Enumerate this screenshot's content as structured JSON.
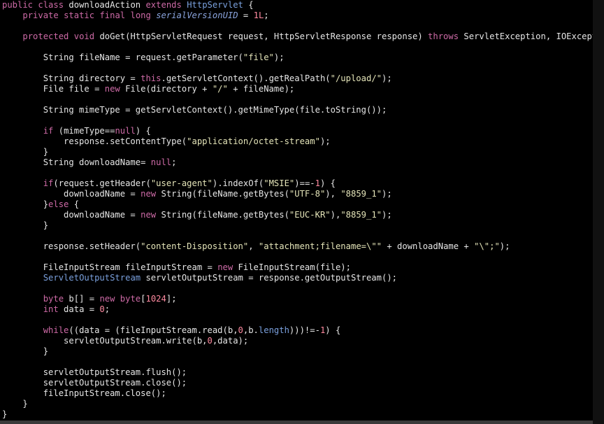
{
  "colors": {
    "background": "#000000",
    "default_text": "#e6e6e6",
    "keyword": "#cd6aa6",
    "type": "#7aa0dd",
    "string": "#e4e4b8",
    "number": "#ff8aa0",
    "field": "#8aa4dd"
  },
  "lines": [
    [
      [
        "kw",
        "public"
      ],
      [
        "p",
        " "
      ],
      [
        "kw",
        "class"
      ],
      [
        "p",
        " downloadAction "
      ],
      [
        "kw",
        "extends"
      ],
      [
        "p",
        " "
      ],
      [
        "type",
        "HttpServlet"
      ],
      [
        "p",
        " {"
      ]
    ],
    [
      [
        "p",
        "    "
      ],
      [
        "kw",
        "private"
      ],
      [
        "p",
        " "
      ],
      [
        "kw",
        "static"
      ],
      [
        "p",
        " "
      ],
      [
        "kw",
        "final"
      ],
      [
        "p",
        " "
      ],
      [
        "kw",
        "long"
      ],
      [
        "p",
        " "
      ],
      [
        "field",
        "serialVersionUID"
      ],
      [
        "p",
        " = "
      ],
      [
        "num",
        "1L"
      ],
      [
        "p",
        ";"
      ]
    ],
    [],
    [
      [
        "p",
        "    "
      ],
      [
        "kw",
        "protected"
      ],
      [
        "p",
        " "
      ],
      [
        "kw",
        "void"
      ],
      [
        "p",
        " doGet(HttpServletRequest request, HttpServletResponse response) "
      ],
      [
        "kw",
        "throws"
      ],
      [
        "p",
        " ServletException, IOException {"
      ]
    ],
    [],
    [
      [
        "p",
        "        String fileName = request.getParameter("
      ],
      [
        "str",
        "\"file\""
      ],
      [
        "p",
        ");"
      ]
    ],
    [],
    [
      [
        "p",
        "        String directory = "
      ],
      [
        "kw",
        "this"
      ],
      [
        "p",
        ".getServletContext().getRealPath("
      ],
      [
        "str",
        "\"/upload/\""
      ],
      [
        "p",
        ");"
      ]
    ],
    [
      [
        "p",
        "        File file = "
      ],
      [
        "kw",
        "new"
      ],
      [
        "p",
        " File(directory + "
      ],
      [
        "str",
        "\"/\""
      ],
      [
        "p",
        " + fileName);"
      ]
    ],
    [],
    [
      [
        "p",
        "        String mimeType = getServletContext().getMimeType(file.toString());"
      ]
    ],
    [],
    [
      [
        "p",
        "        "
      ],
      [
        "kw",
        "if"
      ],
      [
        "p",
        " (mimeType=="
      ],
      [
        "kw",
        "null"
      ],
      [
        "p",
        ") {"
      ]
    ],
    [
      [
        "p",
        "            response.setContentType("
      ],
      [
        "str",
        "\"application/octet-stream\""
      ],
      [
        "p",
        ");"
      ]
    ],
    [
      [
        "p",
        "        }"
      ]
    ],
    [
      [
        "p",
        "        String downloadName= "
      ],
      [
        "kw",
        "null"
      ],
      [
        "p",
        ";"
      ]
    ],
    [],
    [
      [
        "p",
        "        "
      ],
      [
        "kw",
        "if"
      ],
      [
        "p",
        "(request.getHeader("
      ],
      [
        "str",
        "\"user-agent\""
      ],
      [
        "p",
        ").indexOf("
      ],
      [
        "str",
        "\"MSIE\""
      ],
      [
        "p",
        ")==-"
      ],
      [
        "num",
        "1"
      ],
      [
        "p",
        ") {"
      ]
    ],
    [
      [
        "p",
        "            downloadName = "
      ],
      [
        "kw",
        "new"
      ],
      [
        "p",
        " String(fileName.getBytes("
      ],
      [
        "str",
        "\"UTF-8\""
      ],
      [
        "p",
        "), "
      ],
      [
        "str",
        "\"8859_1\""
      ],
      [
        "p",
        ");"
      ]
    ],
    [
      [
        "p",
        "        }"
      ],
      [
        "kw",
        "else"
      ],
      [
        "p",
        " {"
      ]
    ],
    [
      [
        "p",
        "            downloadName = "
      ],
      [
        "kw",
        "new"
      ],
      [
        "p",
        " String(fileName.getBytes("
      ],
      [
        "str",
        "\"EUC-KR\""
      ],
      [
        "p",
        "),"
      ],
      [
        "str",
        "\"8859_1\""
      ],
      [
        "p",
        ");"
      ]
    ],
    [
      [
        "p",
        "        }"
      ]
    ],
    [],
    [
      [
        "p",
        "        response.setHeader("
      ],
      [
        "str",
        "\"content-Disposition\""
      ],
      [
        "p",
        ", "
      ],
      [
        "str",
        "\"attachment;filename=\\\"\""
      ],
      [
        "p",
        " + downloadName + "
      ],
      [
        "str",
        "\"\\\";\""
      ],
      [
        "p",
        ");"
      ]
    ],
    [],
    [
      [
        "p",
        "        FileInputStream fileInputStream = "
      ],
      [
        "kw",
        "new"
      ],
      [
        "p",
        " FileInputStream(file);"
      ]
    ],
    [
      [
        "p",
        "        "
      ],
      [
        "type",
        "ServletOutputStream"
      ],
      [
        "p",
        " servletOutputStream = response.getOutputStream();"
      ]
    ],
    [],
    [
      [
        "p",
        "        "
      ],
      [
        "kw",
        "byte"
      ],
      [
        "p",
        " b[] = "
      ],
      [
        "kw",
        "new"
      ],
      [
        "p",
        " "
      ],
      [
        "kw",
        "byte"
      ],
      [
        "p",
        "["
      ],
      [
        "num",
        "1024"
      ],
      [
        "p",
        "];"
      ]
    ],
    [
      [
        "p",
        "        "
      ],
      [
        "kw",
        "int"
      ],
      [
        "p",
        " data = "
      ],
      [
        "num",
        "0"
      ],
      [
        "p",
        ";"
      ]
    ],
    [],
    [
      [
        "p",
        "        "
      ],
      [
        "kw",
        "while"
      ],
      [
        "p",
        "((data = (fileInputStream.read(b,"
      ],
      [
        "num",
        "0"
      ],
      [
        "p",
        ",b."
      ],
      [
        "type",
        "length"
      ],
      [
        "p",
        ")))!=-"
      ],
      [
        "num",
        "1"
      ],
      [
        "p",
        ") {"
      ]
    ],
    [
      [
        "p",
        "            servletOutputStream.write(b,"
      ],
      [
        "num",
        "0"
      ],
      [
        "p",
        ",data);"
      ]
    ],
    [
      [
        "p",
        "        }"
      ]
    ],
    [],
    [
      [
        "p",
        "        servletOutputStream.flush();"
      ]
    ],
    [
      [
        "p",
        "        servletOutputStream.close();"
      ]
    ],
    [
      [
        "p",
        "        fileInputStream.close();"
      ]
    ],
    [
      [
        "p",
        "    }"
      ]
    ],
    [
      [
        "p",
        "}"
      ]
    ]
  ]
}
